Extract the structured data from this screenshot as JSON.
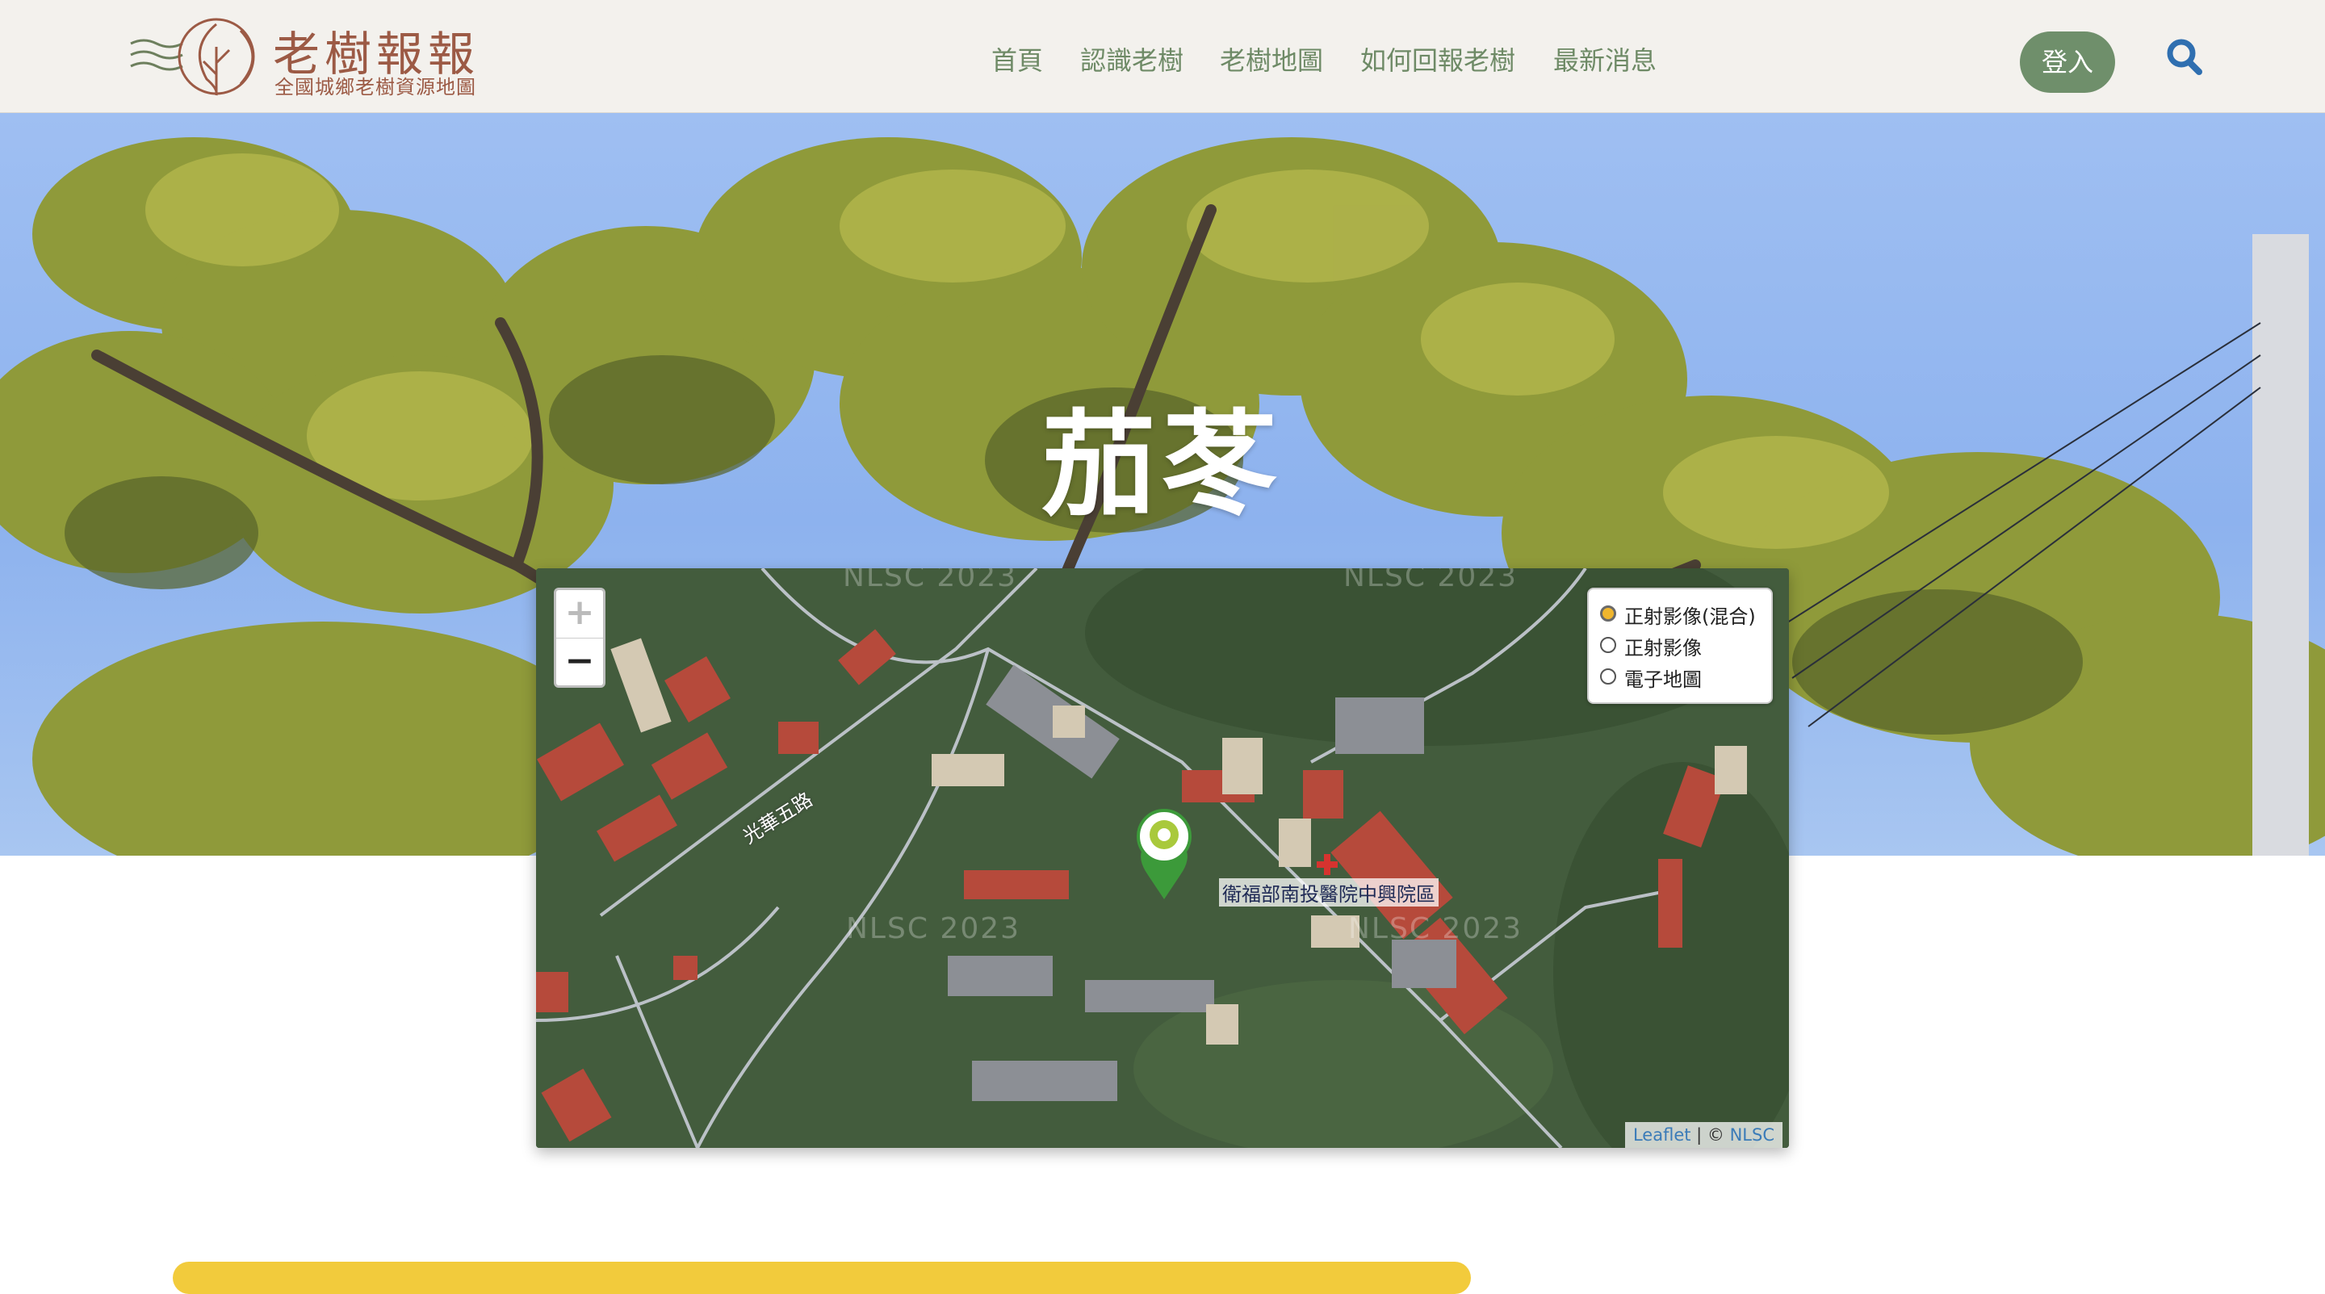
{
  "header": {
    "logo": {
      "title": "老樹報報",
      "subtitle": "全國城鄉老樹資源地圖"
    },
    "nav": [
      {
        "label": "首頁"
      },
      {
        "label": "認識老樹"
      },
      {
        "label": "老樹地圖"
      },
      {
        "label": "如何回報老樹"
      },
      {
        "label": "最新消息"
      }
    ],
    "login_label": "登入",
    "search_icon": "search-icon"
  },
  "hero": {
    "title": "茄苳"
  },
  "map": {
    "zoom_in": "+",
    "zoom_out": "−",
    "layers": [
      {
        "label": "正射影像(混合)",
        "checked": true
      },
      {
        "label": "正射影像",
        "checked": false
      },
      {
        "label": "電子地圖",
        "checked": false
      }
    ],
    "place_label": "衛福部南投醫院中興院區",
    "road_label": "光華五路",
    "watermark": "NLSC 2023",
    "attribution": {
      "leaflet": "Leaflet",
      "separator": " | © ",
      "source": "NLSC"
    },
    "marker_icon": "tree-marker-icon"
  },
  "colors": {
    "header_bg": "#f3f1ed",
    "nav_text": "#6e8a66",
    "login_bg": "#6f8f6b",
    "logo_brown": "#9c5a45",
    "search_blue": "#2f6fb0",
    "marker_green": "#3c9a3a",
    "accent_yellow": "#f2cb3c"
  }
}
